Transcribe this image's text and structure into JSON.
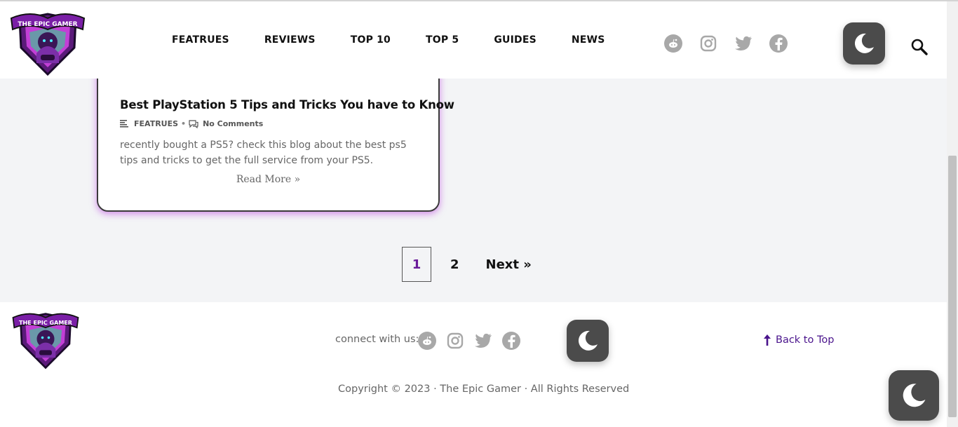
{
  "header": {
    "logo_text": "THE EPIC GAMER",
    "nav": [
      "FEATRUES",
      "REVIEWS",
      "TOP 10",
      "TOP 5",
      "GUIDES",
      "NEWS"
    ],
    "social_icons": [
      "reddit-icon",
      "instagram-icon",
      "twitter-icon",
      "facebook-icon"
    ],
    "search_icon": "search-icon"
  },
  "post": {
    "title": "Best PlayStation 5 Tips and Tricks You have to Know",
    "category": "FEATRUES",
    "comments": "No Comments",
    "excerpt": "recently bought a PS5? check this blog about the best ps5 tips and tricks to get the full service from your PS5.",
    "read_more": "Read More »"
  },
  "pagination": {
    "current": "1",
    "page2": "2",
    "next": "Next »"
  },
  "footer": {
    "connect_label": "connect with us:",
    "back_to_top": "Back to Top",
    "copyright": "Copyright © 2023 · The Epic Gamer · All Rights Reserved"
  },
  "colors": {
    "accent": "#6a1b9a",
    "icon_gray": "#a8a8a8",
    "moon_bg": "#4b4b4b",
    "card_glow": "#b432dc"
  }
}
